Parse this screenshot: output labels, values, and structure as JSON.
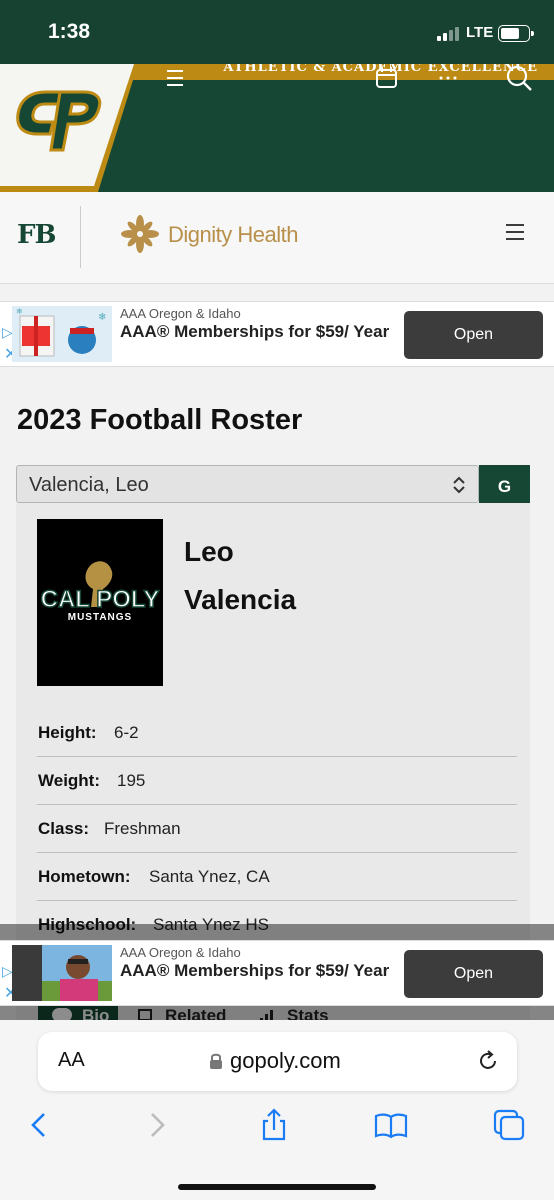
{
  "status_bar": {
    "time": "1:38",
    "network": "LTE"
  },
  "header": {
    "tagline": "ATHLETIC & ACADEMIC EXCELLENCE",
    "logo_icon": "cal-poly-cp-logo",
    "menu_icon": "hamburger-icon",
    "calendar_icon": "calendar-icon",
    "more_icon": "ellipsis-icon",
    "search_icon": "search-icon"
  },
  "sport_bar": {
    "sport": "FB",
    "sponsor": "Dignity Health"
  },
  "ads": [
    {
      "advertiser": "AAA Oregon & Idaho",
      "headline": "AAA® Memberships for $59/ Year",
      "button": "Open"
    },
    {
      "advertiser": "AAA Oregon & Idaho",
      "headline": "AAA® Memberships for $59/ Year",
      "button": "Open"
    }
  ],
  "roster": {
    "title": "2023 Football Roster",
    "selected_player": "Valencia, Leo",
    "go_label": "G",
    "player": {
      "first_name": "Leo",
      "last_name": "Valencia",
      "headshot_text_top": "CAL POLY",
      "headshot_text_bottom": "MUSTANGS"
    },
    "bio": [
      {
        "label": "Height:",
        "value": "6-2"
      },
      {
        "label": "Weight:",
        "value": "195"
      },
      {
        "label": "Class:",
        "value": "Freshman"
      },
      {
        "label": "Hometown:",
        "value": "Santa Ynez, CA"
      },
      {
        "label": "Highschool:",
        "value": "Santa Ynez HS"
      }
    ],
    "tabs": [
      "Bio",
      "Related",
      "Stats"
    ]
  },
  "browser": {
    "text_size_label": "AA",
    "url": "gopoly.com"
  },
  "colors": {
    "brand_green": "#154734",
    "brand_gold": "#bd8b13"
  }
}
